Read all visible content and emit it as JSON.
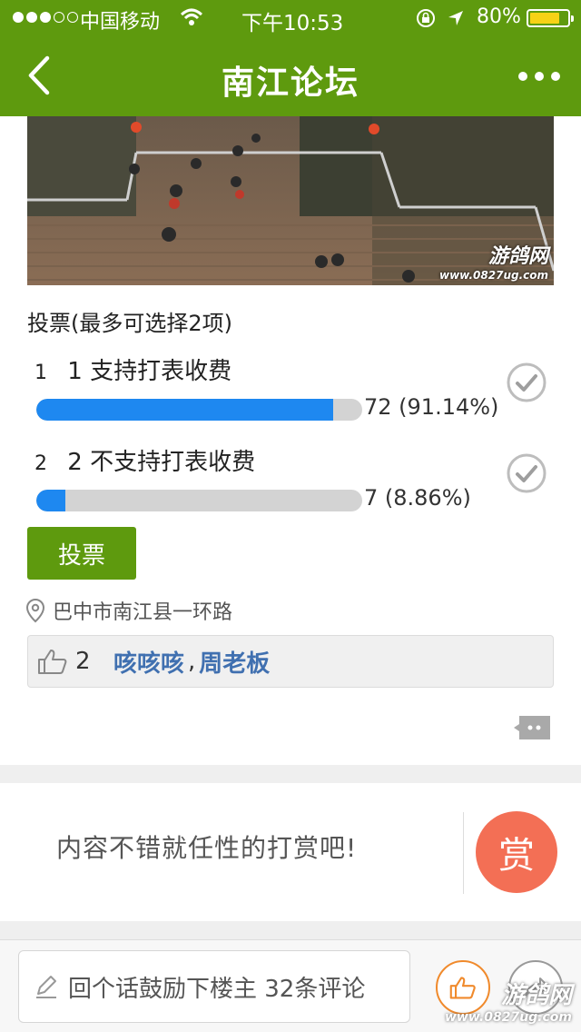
{
  "status_bar": {
    "carrier": "中国移动",
    "time": "下午10:53",
    "battery": "80%",
    "battery_level": 0.8
  },
  "nav": {
    "title": "南江论坛"
  },
  "photo": {
    "watermark_title": "游鸽网",
    "watermark_url": "www.0827ug.com"
  },
  "poll": {
    "title": "投票(最多可选择2项)",
    "options": [
      {
        "index": "1",
        "label": "1 支持打表收费",
        "result": "72 (91.14%)",
        "percent": 91.14
      },
      {
        "index": "2",
        "label": "2 不支持打表收费",
        "result": "7 (8.86%)",
        "percent": 8.86
      }
    ],
    "vote_button": "投票"
  },
  "location": {
    "text": "巴中市南江县一环路"
  },
  "likes": {
    "count": "2",
    "users": [
      "咳咳咳",
      "周老板"
    ],
    "separator": ","
  },
  "reward": {
    "text": "内容不错就任性的打赏吧!",
    "button": "赏"
  },
  "bottom_bar": {
    "placeholder": "回个话鼓励下楼主 32条评论",
    "watermark_title": "游鸽网",
    "watermark_url": "www.0827ug.com"
  },
  "colors": {
    "brand_green": "#5e9a0e",
    "bar_blue": "#1e88f0",
    "reward_red": "#f36f55",
    "like_orange": "#f08a2c"
  }
}
